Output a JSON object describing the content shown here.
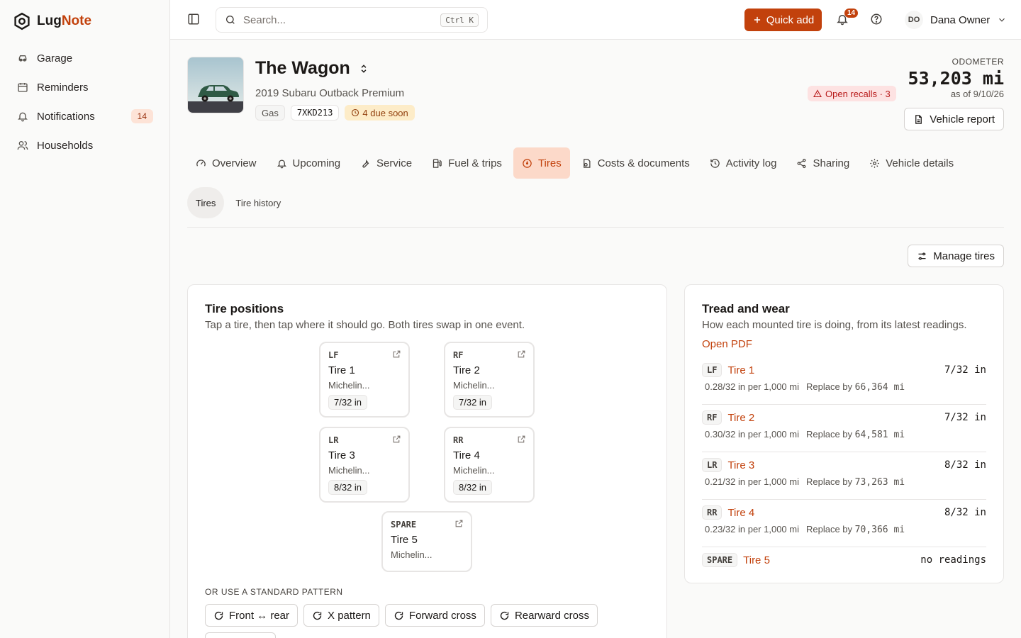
{
  "app": {
    "name_a": "Lug",
    "name_b": "Note"
  },
  "sidebar": {
    "items": [
      {
        "label": "Garage",
        "icon": "car-icon"
      },
      {
        "label": "Reminders",
        "icon": "calendar-icon"
      },
      {
        "label": "Notifications",
        "icon": "bell-icon",
        "badge": "14"
      },
      {
        "label": "Households",
        "icon": "users-icon"
      }
    ]
  },
  "topbar": {
    "search_placeholder": "Search...",
    "search_shortcut": "Ctrl K",
    "quick_add": "Quick add",
    "notif_count": "14",
    "user_initials": "DO",
    "user_name": "Dana Owner"
  },
  "vehicle": {
    "name": "The Wagon",
    "model": "2019 Subaru Outback Premium",
    "fuel": "Gas",
    "plate": "7XKD213",
    "due": "4 due soon",
    "recalls": "Open recalls · 3",
    "odometer_label": "ODOMETER",
    "odometer": "53,203 mi",
    "odometer_as_of": "as of 9/10/26",
    "report_button": "Vehicle report"
  },
  "tabs": [
    {
      "label": "Overview",
      "icon": "gauge-icon",
      "active": false
    },
    {
      "label": "Upcoming",
      "icon": "bell-icon",
      "active": false
    },
    {
      "label": "Service",
      "icon": "wrench-icon",
      "active": false
    },
    {
      "label": "Fuel & trips",
      "icon": "fuel-icon",
      "active": false
    },
    {
      "label": "Tires",
      "icon": "tire-icon",
      "active": true
    },
    {
      "label": "Costs & documents",
      "icon": "receipt-icon",
      "active": false
    },
    {
      "label": "Activity log",
      "icon": "history-icon",
      "active": false
    },
    {
      "label": "Sharing",
      "icon": "share-icon",
      "active": false
    },
    {
      "label": "Vehicle details",
      "icon": "gear-icon",
      "active": false
    }
  ],
  "subtabs": [
    {
      "label": "Tires",
      "active": true
    },
    {
      "label": "Tire history",
      "active": false
    }
  ],
  "manage_button": "Manage tires",
  "positions": {
    "title": "Tire positions",
    "desc": "Tap a tire, then tap where it should go. Both tires swap in one event.",
    "tires": [
      {
        "pos": "LF",
        "name": "Tire 1",
        "brand": "Michelin...",
        "tread": "7/32 in"
      },
      {
        "pos": "RF",
        "name": "Tire 2",
        "brand": "Michelin...",
        "tread": "7/32 in"
      },
      {
        "pos": "LR",
        "name": "Tire 3",
        "brand": "Michelin...",
        "tread": "8/32 in"
      },
      {
        "pos": "RR",
        "name": "Tire 4",
        "brand": "Michelin...",
        "tread": "8/32 in"
      },
      {
        "pos": "SPARE",
        "name": "Tire 5",
        "brand": "Michelin...",
        "tread": ""
      }
    ],
    "pattern_label": "OR USE A STANDARD PATTERN",
    "patterns": [
      "Front ↔ rear",
      "X pattern",
      "Forward cross",
      "Rearward cross"
    ]
  },
  "tread": {
    "title": "Tread and wear",
    "desc": "How each mounted tire is doing, from its latest readings.",
    "link": "Open PDF",
    "rows": [
      {
        "pos": "LF",
        "name": "Tire 1",
        "value": "7/32 in",
        "rate": "0.28/32 in per 1,000 mi",
        "replace_label": "Replace by",
        "replace_val": "66,364 mi"
      },
      {
        "pos": "RF",
        "name": "Tire 2",
        "value": "7/32 in",
        "rate": "0.30/32 in per 1,000 mi",
        "replace_label": "Replace by",
        "replace_val": "64,581 mi"
      },
      {
        "pos": "LR",
        "name": "Tire 3",
        "value": "8/32 in",
        "rate": "0.21/32 in per 1,000 mi",
        "replace_label": "Replace by",
        "replace_val": "73,263 mi"
      },
      {
        "pos": "RR",
        "name": "Tire 4",
        "value": "8/32 in",
        "rate": "0.23/32 in per 1,000 mi",
        "replace_label": "Replace by",
        "replace_val": "70,366 mi"
      },
      {
        "pos": "SPARE",
        "name": "Tire 5",
        "value": "no readings",
        "rate": "",
        "replace_label": "",
        "replace_val": ""
      }
    ]
  },
  "colors": {
    "accent": "#c2410c",
    "active_tab_bg": "#fcd9c9",
    "recall_bg": "#fde2e2",
    "due_bg": "#fdecc8"
  }
}
